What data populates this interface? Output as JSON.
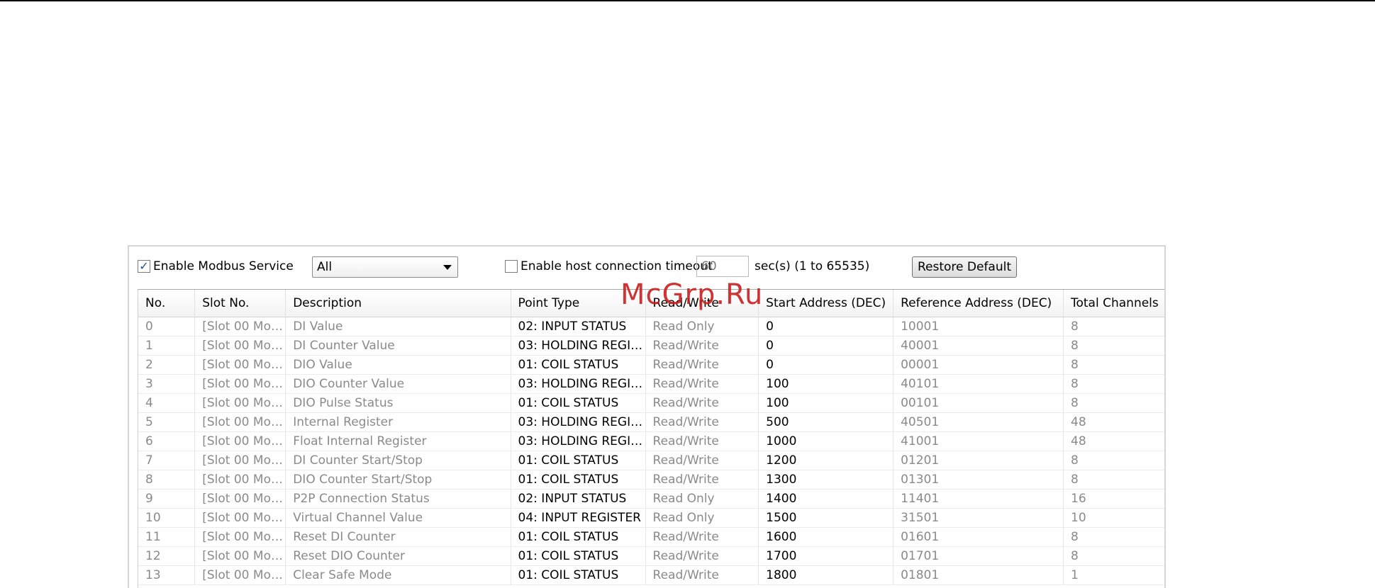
{
  "watermark": "McGrp.Ru",
  "toolbar": {
    "enable_modbus_label": "Enable Modbus Service",
    "enable_modbus_checked": true,
    "filter_value": "All",
    "enable_timeout_label": "Enable host connection timeout",
    "enable_timeout_checked": false,
    "timeout_value": "60",
    "timeout_range_label": "sec(s) (1 to 65535)",
    "restore_default_label": "Restore Default"
  },
  "table": {
    "headers": {
      "no": "No.",
      "slot": "Slot No.",
      "description": "Description",
      "point_type": "Point Type",
      "read_write": "Read/Write",
      "start_address": "Start Address (DEC)",
      "reference_address": "Reference Address (DEC)",
      "total_channels": "Total Channels"
    },
    "rows": [
      {
        "no": "0",
        "slot": "[Slot 00 Mo…",
        "description": "DI Value",
        "point_type": "02: INPUT STATUS",
        "read_write": "Read Only",
        "start_address": "0",
        "reference_address": "10001",
        "total_channels": "8"
      },
      {
        "no": "1",
        "slot": "[Slot 00 Mo…",
        "description": "DI Counter Value",
        "point_type": "03: HOLDING REGI…",
        "read_write": "Read/Write",
        "start_address": "0",
        "reference_address": "40001",
        "total_channels": "8"
      },
      {
        "no": "2",
        "slot": "[Slot 00 Mo…",
        "description": "DIO Value",
        "point_type": "01: COIL STATUS",
        "read_write": "Read/Write",
        "start_address": "0",
        "reference_address": "00001",
        "total_channels": "8"
      },
      {
        "no": "3",
        "slot": "[Slot 00 Mo…",
        "description": "DIO Counter Value",
        "point_type": "03: HOLDING REGI…",
        "read_write": "Read/Write",
        "start_address": "100",
        "reference_address": "40101",
        "total_channels": "8"
      },
      {
        "no": "4",
        "slot": "[Slot 00 Mo…",
        "description": "DIO Pulse Status",
        "point_type": "01: COIL STATUS",
        "read_write": "Read/Write",
        "start_address": "100",
        "reference_address": "00101",
        "total_channels": "8"
      },
      {
        "no": "5",
        "slot": "[Slot 00 Mo…",
        "description": "Internal Register",
        "point_type": "03: HOLDING REGI…",
        "read_write": "Read/Write",
        "start_address": "500",
        "reference_address": "40501",
        "total_channels": "48"
      },
      {
        "no": "6",
        "slot": "[Slot 00 Mo…",
        "description": "Float Internal Register",
        "point_type": "03: HOLDING REGI…",
        "read_write": "Read/Write",
        "start_address": "1000",
        "reference_address": "41001",
        "total_channels": "48"
      },
      {
        "no": "7",
        "slot": "[Slot 00 Mo…",
        "description": "DI Counter Start/Stop",
        "point_type": "01: COIL STATUS",
        "read_write": "Read/Write",
        "start_address": "1200",
        "reference_address": "01201",
        "total_channels": "8"
      },
      {
        "no": "8",
        "slot": "[Slot 00 Mo…",
        "description": "DIO Counter Start/Stop",
        "point_type": "01: COIL STATUS",
        "read_write": "Read/Write",
        "start_address": "1300",
        "reference_address": "01301",
        "total_channels": "8"
      },
      {
        "no": "9",
        "slot": "[Slot 00 Mo…",
        "description": "P2P Connection Status",
        "point_type": "02: INPUT STATUS",
        "read_write": "Read Only",
        "start_address": "1400",
        "reference_address": "11401",
        "total_channels": "16"
      },
      {
        "no": "10",
        "slot": "[Slot 00 Mo…",
        "description": "Virtual Channel Value",
        "point_type": "04: INPUT REGISTER",
        "read_write": "Read Only",
        "start_address": "1500",
        "reference_address": "31501",
        "total_channels": "10"
      },
      {
        "no": "11",
        "slot": "[Slot 00 Mo…",
        "description": "Reset DI Counter",
        "point_type": "01: COIL STATUS",
        "read_write": "Read/Write",
        "start_address": "1600",
        "reference_address": "01601",
        "total_channels": "8"
      },
      {
        "no": "12",
        "slot": "[Slot 00 Mo…",
        "description": "Reset DIO Counter",
        "point_type": "01: COIL STATUS",
        "read_write": "Read/Write",
        "start_address": "1700",
        "reference_address": "01701",
        "total_channels": "8"
      },
      {
        "no": "13",
        "slot": "[Slot 00 Mo…",
        "description": "Clear Safe Mode",
        "point_type": "01: COIL STATUS",
        "read_write": "Read/Write",
        "start_address": "1800",
        "reference_address": "01801",
        "total_channels": "1"
      }
    ]
  }
}
